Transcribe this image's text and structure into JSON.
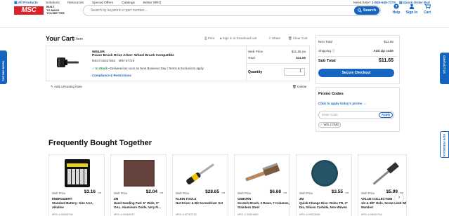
{
  "header": {
    "logo_text": "MSC",
    "logo_tagline_1": "BUILT",
    "logo_tagline_2": "TO MAKE",
    "logo_tagline_3": "YOU BETTER",
    "search_placeholder": "Search by keyword or part number...",
    "search_button": "Search",
    "help_label": "Help",
    "signin_label": "Sign In",
    "cart_label": "Cart",
    "cart_badge": "1"
  },
  "nav": {
    "items": [
      "All Products",
      "Solutions",
      "Resources",
      "Special Offers",
      "Catalogs",
      "Better MRO"
    ],
    "need_help": "Need help?",
    "phone": "1-800-645-7270",
    "quick_order": "Quick Order Pad"
  },
  "side_tabs": {
    "left": "THE BIG BOOK",
    "right": "CONTACT US",
    "right2": "GIVE FEEDBACK"
  },
  "cart": {
    "title": "Your Cart",
    "count": "1 Item",
    "actions": [
      "Print",
      "Sign in to Download cart",
      "Share",
      "Clear Cart"
    ],
    "item": {
      "brand": "WEILER",
      "name": "Power Brush Drive Arbor: Wheel Brush Compatible",
      "msc_num": "MSC# 00227553",
      "mfr_num": "Mfr# 97729",
      "stock_status": "In Stock",
      "stock_note": "• Delivered as soon as Next Business Day | Terms & Exclusions apply",
      "compliance": "Compliance & Restrictions",
      "web_price_label": "Web Price",
      "web_price": "$11.65",
      "web_price_unit": "ea",
      "total_label": "Total",
      "total": "$11.65",
      "qty_label": "Quantity",
      "qty": "1",
      "routing_note": "Add a Routing Note",
      "delete": "Delete"
    }
  },
  "summary": {
    "item_total_label": "Item Total",
    "item_total": "$11.65",
    "shipping_label": "Shipping",
    "shipping_value": "Add zip code",
    "subtotal_label": "Sub Total",
    "subtotal": "$11.65",
    "checkout": "Secure Checkout"
  },
  "promo": {
    "title": "Promo Codes",
    "link": "Click to apply today's promo →",
    "placeholder": "Enter Code",
    "apply": "Apply",
    "tag": "WELCOME"
  },
  "fbt": {
    "title": "Frequently Bought Together",
    "web_price_label": "Web Price",
    "unit": "ea",
    "cards": [
      {
        "price": "$3.16",
        "brand": "ENERGIZER®",
        "desc": "Standard Battery: Size AAA, Alkaline",
        "msc": "MSC # 06905796",
        "img": "battery-pack-image"
      },
      {
        "price": "$2.04",
        "brand": "3M",
        "desc": "Hand Sanding Pad: 6\" Wide, 9\" OAL, Aluminum Oxide, Very Fi...",
        "msc": "MSC # 09364542",
        "img": "sanding-pad-image"
      },
      {
        "price": "$28.65",
        "brand": "KLEIN TOOLS",
        "desc": "Nut Driver & Bit Screwdriver Set",
        "msc": "MSC # 87787133",
        "img": "screwdriver-image"
      },
      {
        "price": "$6.68",
        "brand": "OSBORN",
        "desc": "Scratch Brush, 3 Rows, 7 Columns, Stainless Steel",
        "msc": "MSC # 33901880",
        "img": "scratch-brush-image"
      },
      {
        "price": "$3.55",
        "brand": "3M",
        "desc": "Quick-Change Disc: Roloc TR, 3\" Dia, Silicon Carbide, Non-Woven",
        "msc": "MSC # 09323985",
        "img": "quick-change-disc-image"
      },
      {
        "price": "$5.99",
        "brand": "VALUE COLLECTION",
        "desc": "1/4 & 3/8\" Hole, Screw Lock Wheel Mandrel",
        "msc": "MSC # 08424794",
        "img": "wheel-mandrel-image"
      }
    ]
  },
  "colors": {
    "brand_red": "#d9222a",
    "accent_blue": "#1565c0",
    "stock_green": "#1e8a3a"
  }
}
